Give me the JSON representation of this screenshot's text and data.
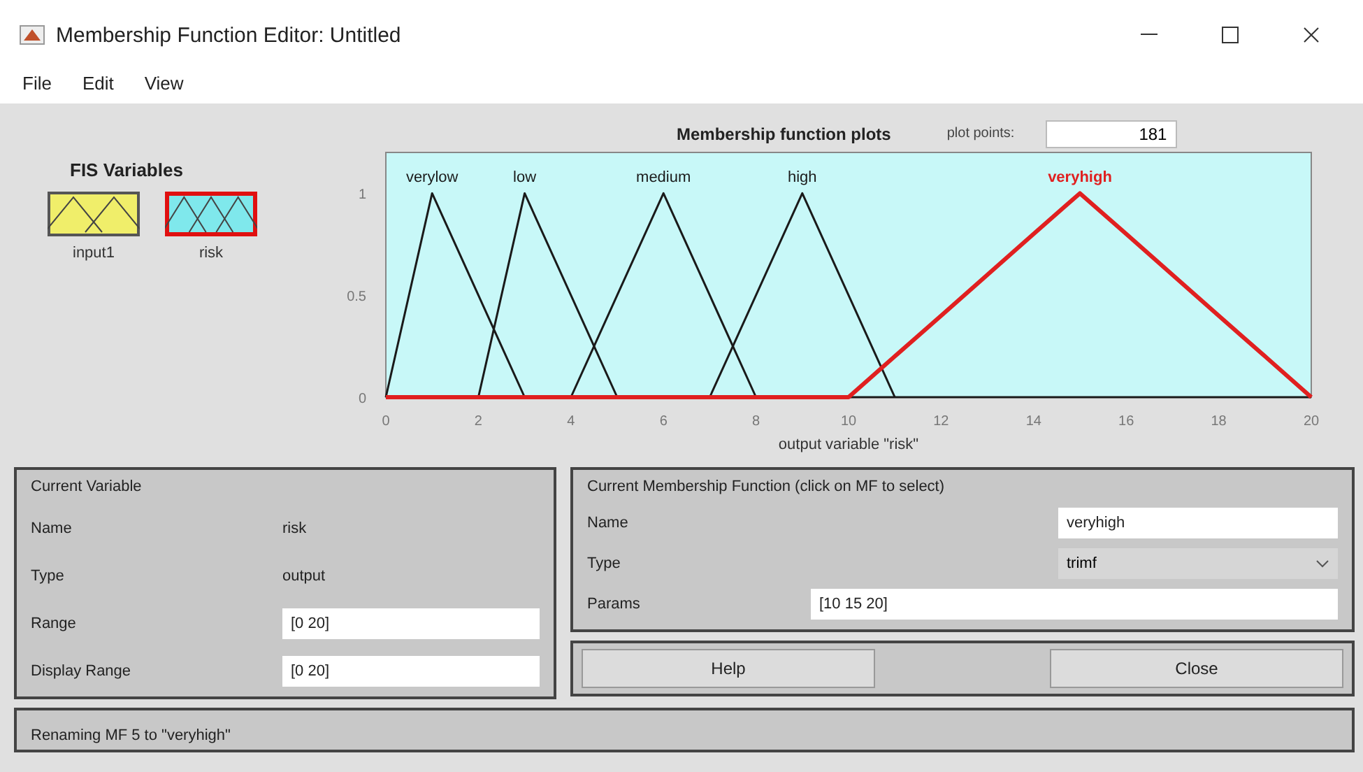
{
  "window": {
    "title": "Membership Function Editor: Untitled"
  },
  "menu": [
    "File",
    "Edit",
    "View"
  ],
  "fis_variables": {
    "title": "FIS Variables",
    "items": [
      {
        "name": "input1",
        "kind": "input",
        "selected": false
      },
      {
        "name": "risk",
        "kind": "output",
        "selected": true
      }
    ]
  },
  "plot": {
    "plot_points_label": "plot points:",
    "plot_points": "181",
    "chart_data": {
      "type": "line",
      "title": "Membership function plots",
      "xlabel": "output variable \"risk\"",
      "x": [
        0,
        1,
        2,
        3,
        4,
        5,
        6,
        7,
        8,
        9,
        10,
        11,
        12,
        13,
        14,
        15,
        16,
        17,
        18,
        19,
        20
      ],
      "xlim": [
        0,
        20
      ],
      "ylim": [
        0,
        1.2
      ],
      "xticks": [
        0,
        2,
        4,
        6,
        8,
        10,
        12,
        14,
        16,
        18,
        20
      ],
      "yticks": [
        0,
        0.5,
        1
      ],
      "series": [
        {
          "name": "verylow",
          "color": "#1a1a1a",
          "values": [
            0,
            1,
            0.5,
            0,
            null,
            null,
            null,
            null,
            null,
            null,
            null,
            null,
            null,
            null,
            null,
            null,
            null,
            null,
            null,
            null,
            null
          ]
        },
        {
          "name": "low",
          "color": "#1a1a1a",
          "values": [
            null,
            null,
            0,
            1,
            0.5,
            0,
            null,
            null,
            null,
            null,
            null,
            null,
            null,
            null,
            null,
            null,
            null,
            null,
            null,
            null,
            null
          ]
        },
        {
          "name": "medium",
          "color": "#1a1a1a",
          "values": [
            null,
            null,
            null,
            null,
            0,
            0.5,
            1,
            0.5,
            0,
            null,
            null,
            null,
            null,
            null,
            null,
            null,
            null,
            null,
            null,
            null,
            null
          ]
        },
        {
          "name": "high",
          "color": "#1a1a1a",
          "values": [
            null,
            null,
            null,
            null,
            null,
            null,
            null,
            0,
            0.5,
            1,
            0.5,
            0,
            null,
            null,
            null,
            null,
            null,
            null,
            null,
            null,
            null
          ]
        },
        {
          "name": "veryhigh",
          "color": "#e02020",
          "values": [
            0,
            0,
            0,
            0,
            0,
            0,
            0,
            0,
            0,
            0,
            0,
            0.2,
            0.4,
            0.6,
            0.8,
            1,
            0.8,
            0.6,
            0.4,
            0.2,
            0
          ]
        }
      ]
    }
  },
  "current_variable": {
    "title": "Current Variable",
    "fields": [
      {
        "label": "Name",
        "value": "risk",
        "kind": "text"
      },
      {
        "label": "Type",
        "value": "output",
        "kind": "text"
      },
      {
        "label": "Range",
        "value": "[0 20]",
        "kind": "input"
      },
      {
        "label": "Display Range",
        "value": "[0 20]",
        "kind": "input"
      }
    ]
  },
  "current_mf": {
    "title": "Current Membership Function (click on MF to select)",
    "name_label": "Name",
    "name_value": "veryhigh",
    "type_label": "Type",
    "type_value": "trimf",
    "params_label": "Params",
    "params_value": "[10 15 20]"
  },
  "buttons": [
    "Help",
    "Close"
  ],
  "status_bar": "Renaming MF 5 to \"veryhigh\""
}
